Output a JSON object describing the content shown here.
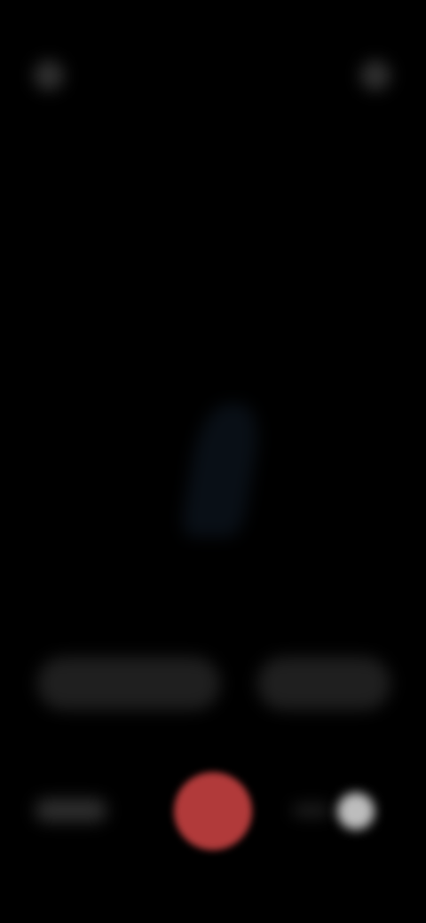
{
  "status_bar": {
    "time": ""
  },
  "top_bar": {
    "left_icon": "circle-icon",
    "right_icon": "circle-icon"
  },
  "viewfinder": {
    "subject": "blurred-figure"
  },
  "modes": {
    "left_label": "",
    "right_label": ""
  },
  "controls": {
    "left_label": "",
    "record_color": "#b13a3a",
    "right_indicator_color": "#bdbdbd"
  }
}
